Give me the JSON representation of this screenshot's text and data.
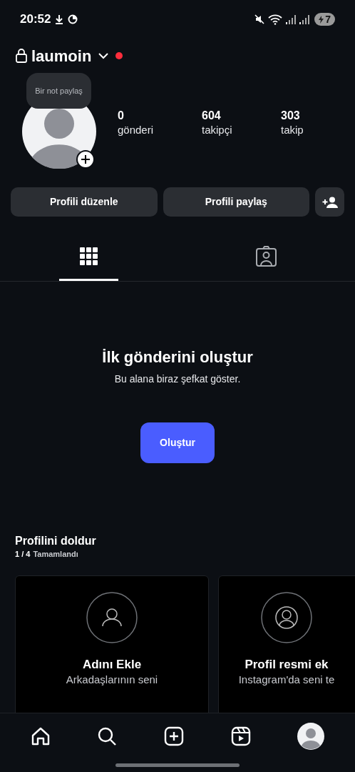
{
  "status_bar": {
    "time": "20:52",
    "battery": "7"
  },
  "header": {
    "username": "laumoin"
  },
  "profile": {
    "note": "Bir not paylaş",
    "stats": [
      {
        "value": "0",
        "label": "gönderi"
      },
      {
        "value": "604",
        "label": "takipçi"
      },
      {
        "value": "303",
        "label": "takip"
      }
    ]
  },
  "buttons": [
    "Profili düzenle",
    "Profili paylaş"
  ],
  "tabs": [
    {
      "kind": "grid",
      "selected": true
    },
    {
      "kind": "tagged",
      "selected": false
    }
  ],
  "empty_state": {
    "title": "İlk gönderini oluştur",
    "subtitle": "Bu alana biraz şefkat göster.",
    "button": "Oluştur"
  },
  "complete_profile": {
    "title": "Profilini doldur",
    "progress": "1 / 4",
    "progress_label": "Tamamlandı",
    "cards": [
      {
        "kind": "name",
        "title": "Adını Ekle",
        "text": "Arkadaşlarının seni"
      },
      {
        "kind": "photo",
        "title": "Profil resmi ek",
        "text": "Instagram'da seni te"
      }
    ]
  }
}
